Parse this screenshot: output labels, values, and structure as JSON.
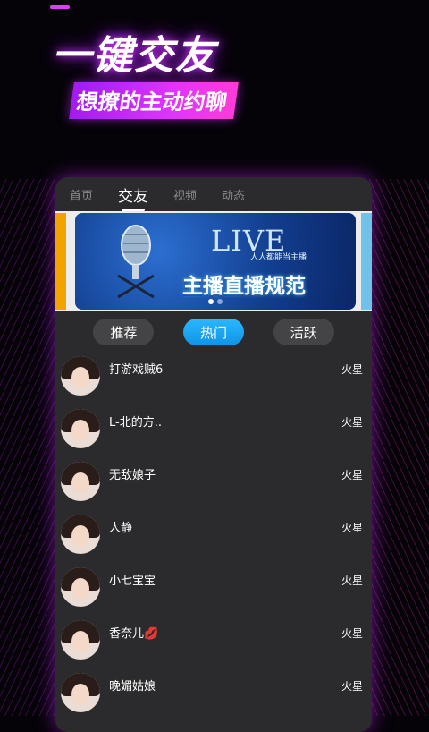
{
  "hero": {
    "title": "一键交友",
    "subtitle": "想撩的主动约聊"
  },
  "tabs": [
    {
      "label": "首页",
      "active": false
    },
    {
      "label": "交友",
      "active": true
    },
    {
      "label": "视频",
      "active": false
    },
    {
      "label": "动态",
      "active": false
    }
  ],
  "banner": {
    "live": "LIVE",
    "live_sub": "人人都能当主播",
    "headline": "主播直播规范",
    "page_count": 2,
    "current_page": 1,
    "edge_left_color": "#f1a400",
    "edge_right_color": "#6fc2e8"
  },
  "filters": [
    {
      "label": "推荐",
      "active": false
    },
    {
      "label": "热门",
      "active": true
    },
    {
      "label": "活跃",
      "active": false
    }
  ],
  "users": [
    {
      "name": "打游戏贼6",
      "location": "火星"
    },
    {
      "name": "L-北的方..",
      "location": "火星"
    },
    {
      "name": "无敌娘子",
      "location": "火星"
    },
    {
      "name": "人静",
      "location": "火星"
    },
    {
      "name": "小七宝宝",
      "location": "火星"
    },
    {
      "name": "香奈儿💋",
      "location": "火星"
    },
    {
      "name": "晚媚姑娘",
      "location": "火星"
    }
  ],
  "colors": {
    "accent_glow": "#d233ff",
    "active_pill": "#1aa6f5",
    "panel_bg": "#2b2b2d"
  }
}
